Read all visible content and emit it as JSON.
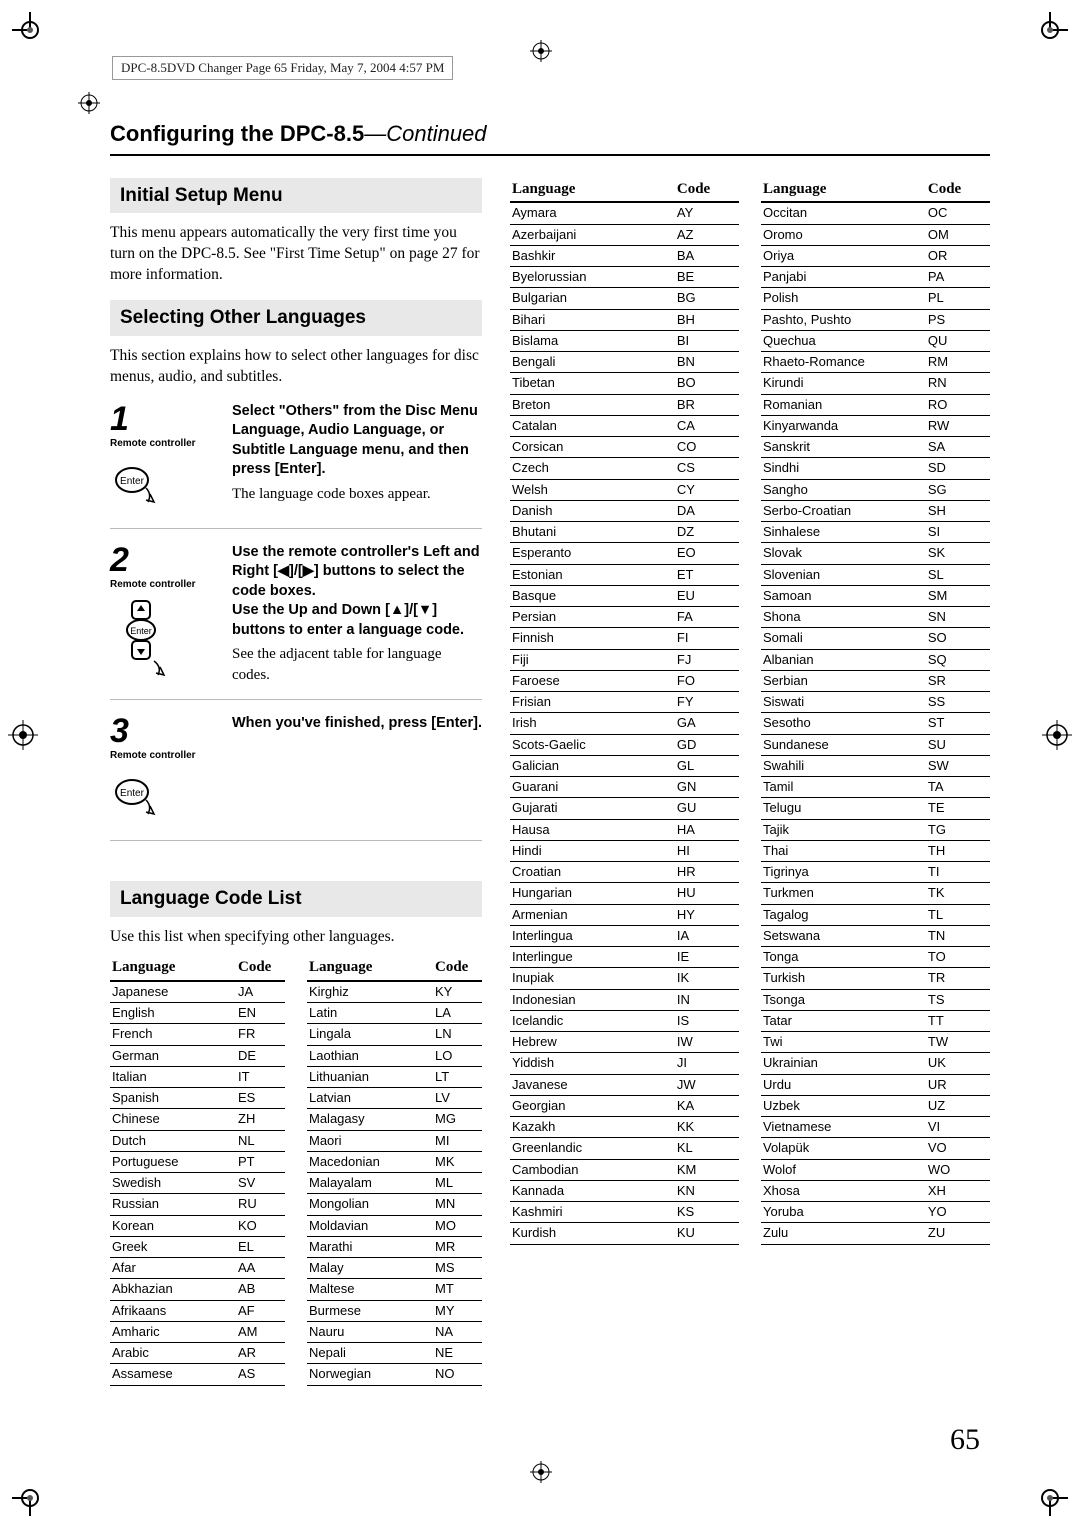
{
  "stamp": "DPC-8.5DVD Changer   Page 65   Friday, May 7, 2004   4:57 PM",
  "section_title_a": "Configuring the DPC-8.5",
  "section_title_b": "—Continued",
  "sub1": "Initial Setup Menu",
  "p1": "This menu appears automatically the very first time you turn on the DPC-8.5. See \"First Time Setup\" on page 27 for more information.",
  "sub2": "Selecting Other Languages",
  "p2": "This section explains how to select other languages for disc menus, audio, and subtitles.",
  "steps": [
    {
      "num": "1",
      "sub": "Remote controller",
      "bold": "Select \"Others\" from the Disc Menu Language, Audio Language, or Subtitle Language menu, and then press [Enter].",
      "plain": "The language code boxes appear."
    },
    {
      "num": "2",
      "sub": "Remote controller",
      "bold": "Use the remote controller's Left and Right [◀]/[▶] buttons to select the code boxes.\nUse the Up and Down [▲]/[▼] buttons to enter a language code.",
      "plain": "See the adjacent table for language codes."
    },
    {
      "num": "3",
      "sub": "Remote controller",
      "bold": "When you've finished, press [Enter].",
      "plain": ""
    }
  ],
  "sub3": "Language Code List",
  "p3": "Use this list when specifying other languages.",
  "th_lang": "Language",
  "th_code": "Code",
  "col1": [
    [
      "Japanese",
      "JA"
    ],
    [
      "English",
      "EN"
    ],
    [
      "French",
      "FR"
    ],
    [
      "German",
      "DE"
    ],
    [
      "Italian",
      "IT"
    ],
    [
      "Spanish",
      "ES"
    ],
    [
      "Chinese",
      "ZH"
    ],
    [
      "Dutch",
      "NL"
    ],
    [
      "Portuguese",
      "PT"
    ],
    [
      "Swedish",
      "SV"
    ],
    [
      "Russian",
      "RU"
    ],
    [
      "Korean",
      "KO"
    ],
    [
      "Greek",
      "EL"
    ],
    [
      "Afar",
      "AA"
    ],
    [
      "Abkhazian",
      "AB"
    ],
    [
      "Afrikaans",
      "AF"
    ],
    [
      "Amharic",
      "AM"
    ],
    [
      "Arabic",
      "AR"
    ],
    [
      "Assamese",
      "AS"
    ]
  ],
  "col2": [
    [
      "Kirghiz",
      "KY"
    ],
    [
      "Latin",
      "LA"
    ],
    [
      "Lingala",
      "LN"
    ],
    [
      "Laothian",
      "LO"
    ],
    [
      "Lithuanian",
      "LT"
    ],
    [
      "Latvian",
      "LV"
    ],
    [
      "Malagasy",
      "MG"
    ],
    [
      "Maori",
      "MI"
    ],
    [
      "Macedonian",
      "MK"
    ],
    [
      "Malayalam",
      "ML"
    ],
    [
      "Mongolian",
      "MN"
    ],
    [
      "Moldavian",
      "MO"
    ],
    [
      "Marathi",
      "MR"
    ],
    [
      "Malay",
      "MS"
    ],
    [
      "Maltese",
      "MT"
    ],
    [
      "Burmese",
      "MY"
    ],
    [
      "Nauru",
      "NA"
    ],
    [
      "Nepali",
      "NE"
    ],
    [
      "Norwegian",
      "NO"
    ]
  ],
  "col3": [
    [
      "Aymara",
      "AY"
    ],
    [
      "Azerbaijani",
      "AZ"
    ],
    [
      "Bashkir",
      "BA"
    ],
    [
      "Byelorussian",
      "BE"
    ],
    [
      "Bulgarian",
      "BG"
    ],
    [
      "Bihari",
      "BH"
    ],
    [
      "Bislama",
      "BI"
    ],
    [
      "Bengali",
      "BN"
    ],
    [
      "Tibetan",
      "BO"
    ],
    [
      "Breton",
      "BR"
    ],
    [
      "Catalan",
      "CA"
    ],
    [
      "Corsican",
      "CO"
    ],
    [
      "Czech",
      "CS"
    ],
    [
      "Welsh",
      "CY"
    ],
    [
      "Danish",
      "DA"
    ],
    [
      "Bhutani",
      "DZ"
    ],
    [
      "Esperanto",
      "EO"
    ],
    [
      "Estonian",
      "ET"
    ],
    [
      "Basque",
      "EU"
    ],
    [
      "Persian",
      "FA"
    ],
    [
      "Finnish",
      "FI"
    ],
    [
      "Fiji",
      "FJ"
    ],
    [
      "Faroese",
      "FO"
    ],
    [
      "Frisian",
      "FY"
    ],
    [
      "Irish",
      "GA"
    ],
    [
      "Scots-Gaelic",
      "GD"
    ],
    [
      "Galician",
      "GL"
    ],
    [
      "Guarani",
      "GN"
    ],
    [
      "Gujarati",
      "GU"
    ],
    [
      "Hausa",
      "HA"
    ],
    [
      "Hindi",
      "HI"
    ],
    [
      "Croatian",
      "HR"
    ],
    [
      "Hungarian",
      "HU"
    ],
    [
      "Armenian",
      "HY"
    ],
    [
      "Interlingua",
      "IA"
    ],
    [
      "Interlingue",
      "IE"
    ],
    [
      "Inupiak",
      "IK"
    ],
    [
      "Indonesian",
      "IN"
    ],
    [
      "Icelandic",
      "IS"
    ],
    [
      "Hebrew",
      "IW"
    ],
    [
      "Yiddish",
      "JI"
    ],
    [
      "Javanese",
      "JW"
    ],
    [
      "Georgian",
      "KA"
    ],
    [
      "Kazakh",
      "KK"
    ],
    [
      "Greenlandic",
      "KL"
    ],
    [
      "Cambodian",
      "KM"
    ],
    [
      "Kannada",
      "KN"
    ],
    [
      "Kashmiri",
      "KS"
    ],
    [
      "Kurdish",
      "KU"
    ]
  ],
  "col4": [
    [
      "Occitan",
      "OC"
    ],
    [
      "Oromo",
      "OM"
    ],
    [
      "Oriya",
      "OR"
    ],
    [
      "Panjabi",
      "PA"
    ],
    [
      "Polish",
      "PL"
    ],
    [
      "Pashto, Pushto",
      "PS"
    ],
    [
      "Quechua",
      "QU"
    ],
    [
      "Rhaeto-Romance",
      "RM"
    ],
    [
      "Kirundi",
      "RN"
    ],
    [
      "Romanian",
      "RO"
    ],
    [
      "Kinyarwanda",
      "RW"
    ],
    [
      "Sanskrit",
      "SA"
    ],
    [
      "Sindhi",
      "SD"
    ],
    [
      "Sangho",
      "SG"
    ],
    [
      "Serbo-Croatian",
      "SH"
    ],
    [
      "Sinhalese",
      "SI"
    ],
    [
      "Slovak",
      "SK"
    ],
    [
      "Slovenian",
      "SL"
    ],
    [
      "Samoan",
      "SM"
    ],
    [
      "Shona",
      "SN"
    ],
    [
      "Somali",
      "SO"
    ],
    [
      "Albanian",
      "SQ"
    ],
    [
      "Serbian",
      "SR"
    ],
    [
      "Siswati",
      "SS"
    ],
    [
      "Sesotho",
      "ST"
    ],
    [
      "Sundanese",
      "SU"
    ],
    [
      "Swahili",
      "SW"
    ],
    [
      "Tamil",
      "TA"
    ],
    [
      "Telugu",
      "TE"
    ],
    [
      "Tajik",
      "TG"
    ],
    [
      "Thai",
      "TH"
    ],
    [
      "Tigrinya",
      "TI"
    ],
    [
      "Turkmen",
      "TK"
    ],
    [
      "Tagalog",
      "TL"
    ],
    [
      "Setswana",
      "TN"
    ],
    [
      "Tonga",
      "TO"
    ],
    [
      "Turkish",
      "TR"
    ],
    [
      "Tsonga",
      "TS"
    ],
    [
      "Tatar",
      "TT"
    ],
    [
      "Twi",
      "TW"
    ],
    [
      "Ukrainian",
      "UK"
    ],
    [
      "Urdu",
      "UR"
    ],
    [
      "Uzbek",
      "UZ"
    ],
    [
      "Vietnamese",
      "VI"
    ],
    [
      "Volapük",
      "VO"
    ],
    [
      "Wolof",
      "WO"
    ],
    [
      "Xhosa",
      "XH"
    ],
    [
      "Yoruba",
      "YO"
    ],
    [
      "Zulu",
      "ZU"
    ]
  ],
  "page_num": "65"
}
